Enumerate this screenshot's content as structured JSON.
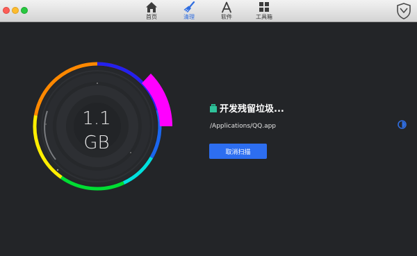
{
  "toolbar": {
    "tabs": [
      {
        "label": "首页",
        "icon": "home-icon",
        "active": false
      },
      {
        "label": "清理",
        "icon": "broom-icon",
        "active": true
      },
      {
        "label": "软件",
        "icon": "app-store-icon",
        "active": false
      },
      {
        "label": "工具箱",
        "icon": "grid-icon",
        "active": false
      }
    ],
    "accent": "#2f6de0"
  },
  "gauge": {
    "size_value": "1.1",
    "size_unit": "GB",
    "ring_colors": [
      "#ff0000",
      "#ff8800",
      "#ffee00",
      "#00dd33",
      "#00e0dd",
      "#1a66ee",
      "#2222ee",
      "#ff00ff"
    ]
  },
  "scan": {
    "status": "开发残留垃圾...",
    "current_path": "/Applications/QQ.app",
    "cancel_label": "取消扫描"
  },
  "colors": {
    "background": "#232528",
    "button": "#2d6ef0"
  }
}
